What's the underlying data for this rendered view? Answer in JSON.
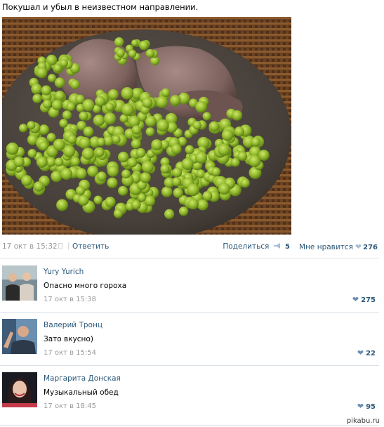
{
  "post": {
    "text": "Покушал и убыл в неизвестном направлении.",
    "date": "17 окт в 15:32",
    "apple_icon": "apple-icon",
    "reply_label": "Ответить",
    "share_label": "Поделиться",
    "share_count": "5",
    "like_label": "Мне нравится",
    "like_count": "276"
  },
  "comments": [
    {
      "name": "Yury Yurich",
      "text": "Опасно много гороха",
      "time": "17 окт в 15:38",
      "likes": "275"
    },
    {
      "name": "Валерий Тронц",
      "text": "Зато вкусно)",
      "time": "17 окт в 15:54",
      "likes": "22"
    },
    {
      "name": "Маргарита Донская",
      "text": "Музыкальный обед",
      "time": "17 окт в 18:45",
      "likes": "95"
    }
  ],
  "watermark": "pikabu.ru",
  "colors": {
    "link": "#2b587a",
    "muted": "#999999",
    "divider": "#dae1e8"
  }
}
